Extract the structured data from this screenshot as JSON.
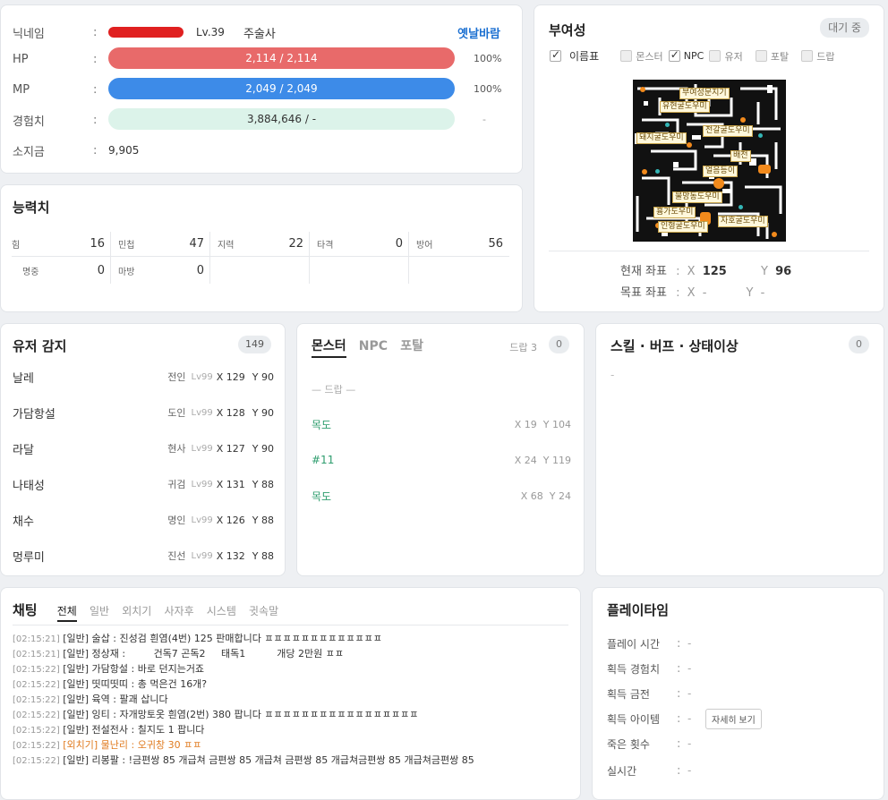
{
  "profile": {
    "nickname_label": "닉네임",
    "level": "Lv.39",
    "job": "주술사",
    "server": "옛날바람",
    "hp_label": "HP",
    "hp_value": "2,114 / 2,114",
    "hp_pct": "100%",
    "mp_label": "MP",
    "mp_value": "2,049 / 2,049",
    "mp_pct": "100%",
    "exp_label": "경험치",
    "exp_value": "3,884,646 / -",
    "exp_pct": "-",
    "gold_label": "소지금",
    "gold_value": "9,905",
    "colon": ":",
    "hp_fill": 1.0,
    "mp_fill": 1.0,
    "hp_color": "#e86a6a",
    "mp_color": "#3d8be8",
    "exp_color": "#dcf3ea"
  },
  "stats": {
    "title": "능력치",
    "rows": [
      [
        {
          "k": "힘",
          "v": "16"
        },
        {
          "k": "민첩",
          "v": "47"
        },
        {
          "k": "지력",
          "v": "22"
        },
        {
          "k": "타격",
          "v": "0"
        },
        {
          "k": "방어",
          "v": "56"
        }
      ],
      [
        {
          "k": "명중",
          "v": "0"
        },
        {
          "k": "마방",
          "v": "0"
        },
        {
          "k": "",
          "v": ""
        },
        {
          "k": "",
          "v": ""
        },
        {
          "k": "",
          "v": ""
        }
      ]
    ]
  },
  "map": {
    "title": "부여성",
    "status": "대기 중",
    "filters": [
      {
        "label": "이름표",
        "checked": true
      },
      {
        "label": "몬스터",
        "checked": false
      },
      {
        "label": "NPC",
        "checked": true
      },
      {
        "label": "유저",
        "checked": false
      },
      {
        "label": "포탈",
        "checked": false
      },
      {
        "label": "드랍",
        "checked": false
      }
    ],
    "labels": [
      "부여성문지기",
      "유현굴도우미",
      "전갈굴도우미",
      "돼지굴도우미",
      "배전",
      "얼음등이",
      "물망동도우미",
      "흉가도우미",
      "자호굴도우미",
      "인형굴도우미"
    ],
    "current_label": "현재 좌표",
    "target_label": "목표 좌표",
    "cur_x": "125",
    "cur_y": "96",
    "tgt_x": "-",
    "tgt_y": "-",
    "x_label": "X",
    "y_label": "Y",
    "colon": ":"
  },
  "users": {
    "title": "유저 감지",
    "count": "149",
    "items": [
      {
        "name": "날레",
        "job": "전인",
        "lv": "Lv99",
        "x": "X 129",
        "y": "Y 90"
      },
      {
        "name": "가담항설",
        "job": "도인",
        "lv": "Lv99",
        "x": "X 128",
        "y": "Y 90"
      },
      {
        "name": "라달",
        "job": "현사",
        "lv": "Lv99",
        "x": "X 127",
        "y": "Y 90"
      },
      {
        "name": "나태성",
        "job": "귀검",
        "lv": "Lv99",
        "x": "X 131",
        "y": "Y 88"
      },
      {
        "name": "채수",
        "job": "명인",
        "lv": "Lv99",
        "x": "X 126",
        "y": "Y 88"
      },
      {
        "name": "멍루미",
        "job": "진선",
        "lv": "Lv99",
        "x": "X 132",
        "y": "Y 88"
      }
    ]
  },
  "monsters": {
    "tabs": [
      "몬스터",
      "NPC",
      "포탈"
    ],
    "drop_label": "드랍 3",
    "count": "0",
    "drop_header": "— 드랍 —",
    "items": [
      {
        "name": "목도",
        "x": "X 19",
        "y": "Y 104"
      },
      {
        "name": "#11",
        "x": "X 24",
        "y": "Y 119"
      },
      {
        "name": "목도",
        "x": "X 68",
        "y": "Y 24"
      }
    ]
  },
  "skills": {
    "title": "스킬 · 버프 · 상태이상",
    "count": "0",
    "empty": "-"
  },
  "chat": {
    "title": "채팅",
    "tabs": [
      "전체",
      "일반",
      "외치기",
      "사자후",
      "시스템",
      "귓속말"
    ],
    "lines": [
      {
        "time": "[02:15:21]",
        "text": "[일반] 술삽 : 진성검 흰염(4번) 125 판매합니다 ㅍㅍㅍㅍㅍㅍㅍㅍㅍㅍㅍㅍㅍ",
        "type": "normal"
      },
      {
        "time": "[02:15:21]",
        "text": "[일반] 정상재 :         건독7 곤독2     태독1          개당 2만원 ㅍㅍ",
        "type": "normal"
      },
      {
        "time": "[02:15:22]",
        "text": "[일반] 가담항설 : 바로 던지는거죠",
        "type": "normal"
      },
      {
        "time": "[02:15:22]",
        "text": "[일반] 띳띠띳띠 : 총 먹은건 16개?",
        "type": "normal"
      },
      {
        "time": "[02:15:22]",
        "text": "[일반] 육역 : 팔괘 삽니다",
        "type": "normal"
      },
      {
        "time": "[02:15:22]",
        "text": "[일반] 잉티 : 자개망토옷 흰염(2번)  380 팝니다 ㅍㅍㅍㅍㅍㅍㅍㅍㅍㅍㅍㅍㅍㅍㅍㅍㅍ",
        "type": "normal"
      },
      {
        "time": "[02:15:22]",
        "text": "[일반] 전설전사 : 칠지도 1 팝니다",
        "type": "normal"
      },
      {
        "time": "[02:15:22]",
        "text": "[외치기] 물난리 : 오귀창 30 ㅍㅍ",
        "type": "shout"
      },
      {
        "time": "[02:15:22]",
        "text": "[일반] 리봉팔 : !금편쌍 85 개급쳐 금편쌍 85 개급쳐 금편쌍 85 개급쳐금편쌍 85 개급쳐금편쌍 85",
        "type": "normal"
      }
    ]
  },
  "playtime": {
    "title": "플레이타임",
    "colon": ":",
    "rows": [
      {
        "k": "플레이 시간",
        "v": "-"
      },
      {
        "k": "획득 경험치",
        "v": "-"
      },
      {
        "k": "획득 금전",
        "v": "-"
      },
      {
        "k": "획득 아이템",
        "v": "-"
      },
      {
        "k": "죽은 횟수",
        "v": "-"
      },
      {
        "k": "실시간",
        "v": "-"
      }
    ],
    "detail_button": "자세히 보기"
  }
}
